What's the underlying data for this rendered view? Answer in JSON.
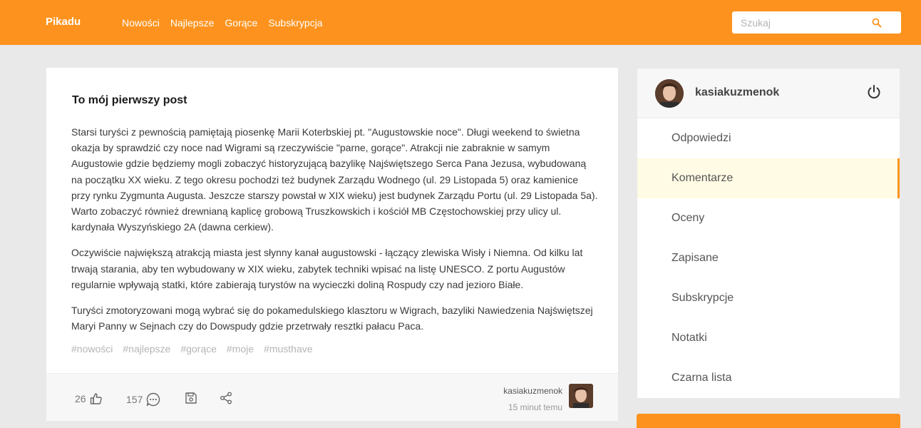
{
  "header": {
    "logo": "Pikadu",
    "nav": [
      "Nowości",
      "Najlepsze",
      "Gorące",
      "Subskrypcja"
    ],
    "search_placeholder": "Szukaj",
    "icon": "search-icon"
  },
  "post": {
    "title": "To mój pierwszy post",
    "paragraphs": [
      "Starsi turyści z pewnością pamiętają piosenkę Marii Koterbskiej pt. \"Augustowskie noce\". Długi weekend to świetna okazja by sprawdzić czy noce nad Wigrami są rzeczywiście \"parne, gorące\". Atrakcji nie zabraknie w samym Augustowie gdzie będziemy mogli zobaczyć historyzującą bazylikę Najświętszego Serca Pana Jezusa, wybudowaną na początku XX wieku. Z tego okresu pochodzi też budynek Zarządu Wodnego (ul. 29 Listopada 5) oraz kamienice przy rynku Zygmunta Augusta. Jeszcze starszy powstał w XIX wieku) jest budynek Zarządu Portu (ul. 29 Listopada 5a). Warto zobaczyć również drewnianą kaplicę grobową Truszkowskich i kościół MB Częstochowskiej przy ulicy ul. kardynała Wyszyńskiego 2A (dawna cerkiew).",
      "Oczywiście największą atrakcją miasta jest słynny kanał augustowski - łączący zlewiska Wisły i Niemna. Od kilku lat trwają starania, aby ten wybudowany w XIX wieku, zabytek techniki wpisać na listę UNESCO. Z portu Augustów regularnie wpływają statki, które zabierają turystów na wycieczki doliną Rospudy czy nad jezioro Białe.",
      "Turyści zmotoryzowani mogą wybrać się do pokamedulskiego klasztoru w Wigrach, bazyliki Nawiedzenia Najświętszej Maryi Panny w Sejnach czy do Dowspudy gdzie przetrwały resztki pałacu Paca."
    ],
    "tags": [
      "#nowości",
      "#najlepsze",
      "#gorące",
      "#moje",
      "#musthave"
    ],
    "likes": "26",
    "comments": "157",
    "author": "kasiakuzmenok",
    "time": "15 minut temu",
    "icons": [
      "like-icon",
      "comment-icon",
      "save-icon",
      "share-icon"
    ]
  },
  "sidebar": {
    "username": "kasiakuzmenok",
    "items": [
      "Odpowiedzi",
      "Komentarze",
      "Oceny",
      "Zapisane",
      "Subskrypcje",
      "Notatki",
      "Czarna lista"
    ],
    "active_index": 1
  },
  "colors": {
    "accent": "#fd931e",
    "active_bg": "#fffbe4",
    "background": "#e9e9e9"
  }
}
